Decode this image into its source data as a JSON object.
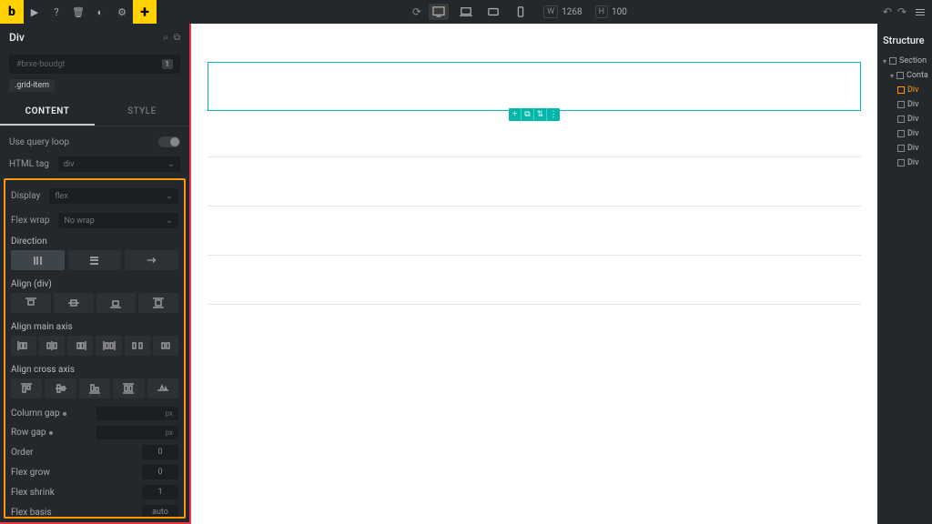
{
  "topbar": {
    "logo": "b",
    "add": "+",
    "width_label": "W",
    "width_val": "1268",
    "height_label": "H",
    "zoom_val": "100"
  },
  "left": {
    "title": "Div",
    "selector_placeholder": "#brxe-boudgt",
    "selector_count": "1",
    "class": ".grid-item",
    "tabs": {
      "content": "CONTENT",
      "style": "STYLE"
    },
    "controls": {
      "query_loop": "Use query loop",
      "html_tag_label": "HTML tag",
      "html_tag_value": "div",
      "display_label": "Display",
      "display_value": "flex",
      "wrap_label": "Flex wrap",
      "wrap_value": "No wrap",
      "direction": "Direction",
      "align_div": "Align (div)",
      "align_main": "Align main axis",
      "align_cross": "Align cross axis",
      "col_gap": "Column gap",
      "row_gap": "Row gap",
      "order": "Order",
      "flex_grow": "Flex grow",
      "flex_shrink": "Flex shrink",
      "flex_basis": "Flex basis",
      "unit_px": "px",
      "val_zero": "0",
      "val_one": "1",
      "val_auto": "auto"
    }
  },
  "right": {
    "title": "Structure",
    "items": [
      {
        "label": "Section",
        "indent": 0
      },
      {
        "label": "Container",
        "indent": 1
      },
      {
        "label": "Div",
        "indent": 2,
        "sel": true
      },
      {
        "label": "Div",
        "indent": 2
      },
      {
        "label": "Div",
        "indent": 2
      },
      {
        "label": "Div",
        "indent": 2
      },
      {
        "label": "Div",
        "indent": 2
      },
      {
        "label": "Div",
        "indent": 2
      }
    ]
  }
}
